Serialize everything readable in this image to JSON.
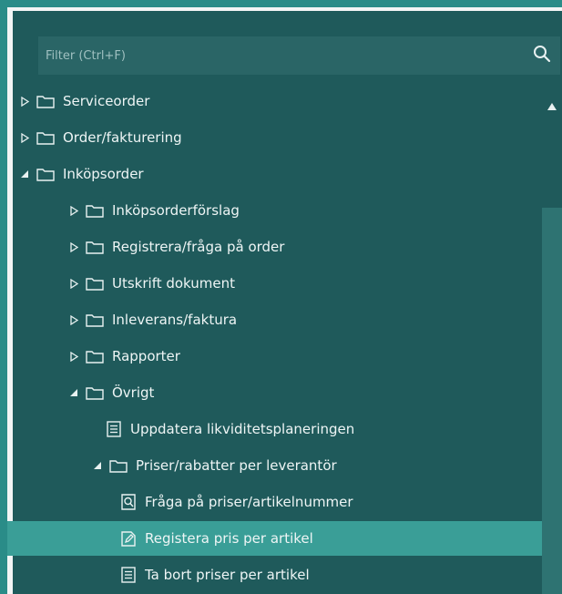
{
  "filter": {
    "placeholder": "Filter (Ctrl+F)",
    "value": ""
  },
  "colors": {
    "panel_bg": "#1f5a5b",
    "selected_bg": "#3a9e97",
    "accent_border": "#2a8c88"
  },
  "tree": [
    {
      "label": "Serviceorder",
      "type": "folder",
      "state": "collapsed",
      "level": 0
    },
    {
      "label": "Order/fakturering",
      "type": "folder",
      "state": "collapsed",
      "level": 0
    },
    {
      "label": "Inköpsorder",
      "type": "folder",
      "state": "expanded",
      "level": 0
    },
    {
      "label": "Inköpsorderförslag",
      "type": "folder",
      "state": "collapsed",
      "level": 1
    },
    {
      "label": "Registrera/fråga på order",
      "type": "folder",
      "state": "collapsed",
      "level": 1
    },
    {
      "label": "Utskrift dokument",
      "type": "folder",
      "state": "collapsed",
      "level": 1
    },
    {
      "label": "Inleverans/faktura",
      "type": "folder",
      "state": "collapsed",
      "level": 1
    },
    {
      "label": "Rapporter",
      "type": "folder",
      "state": "collapsed",
      "level": 1
    },
    {
      "label": "Övrigt",
      "type": "folder",
      "state": "expanded",
      "level": 1
    },
    {
      "label": "Uppdatera likviditetsplaneringen",
      "type": "document",
      "level": 3
    },
    {
      "label": "Priser/rabatter per leverantör",
      "type": "folder",
      "state": "expanded",
      "level": 2
    },
    {
      "label": "Fråga på priser/artikelnummer",
      "type": "query",
      "level": 4
    },
    {
      "label": "Registera pris per artikel",
      "type": "edit",
      "level": 4,
      "selected": true
    },
    {
      "label": "Ta bort priser per artikel",
      "type": "document",
      "level": 4
    }
  ]
}
